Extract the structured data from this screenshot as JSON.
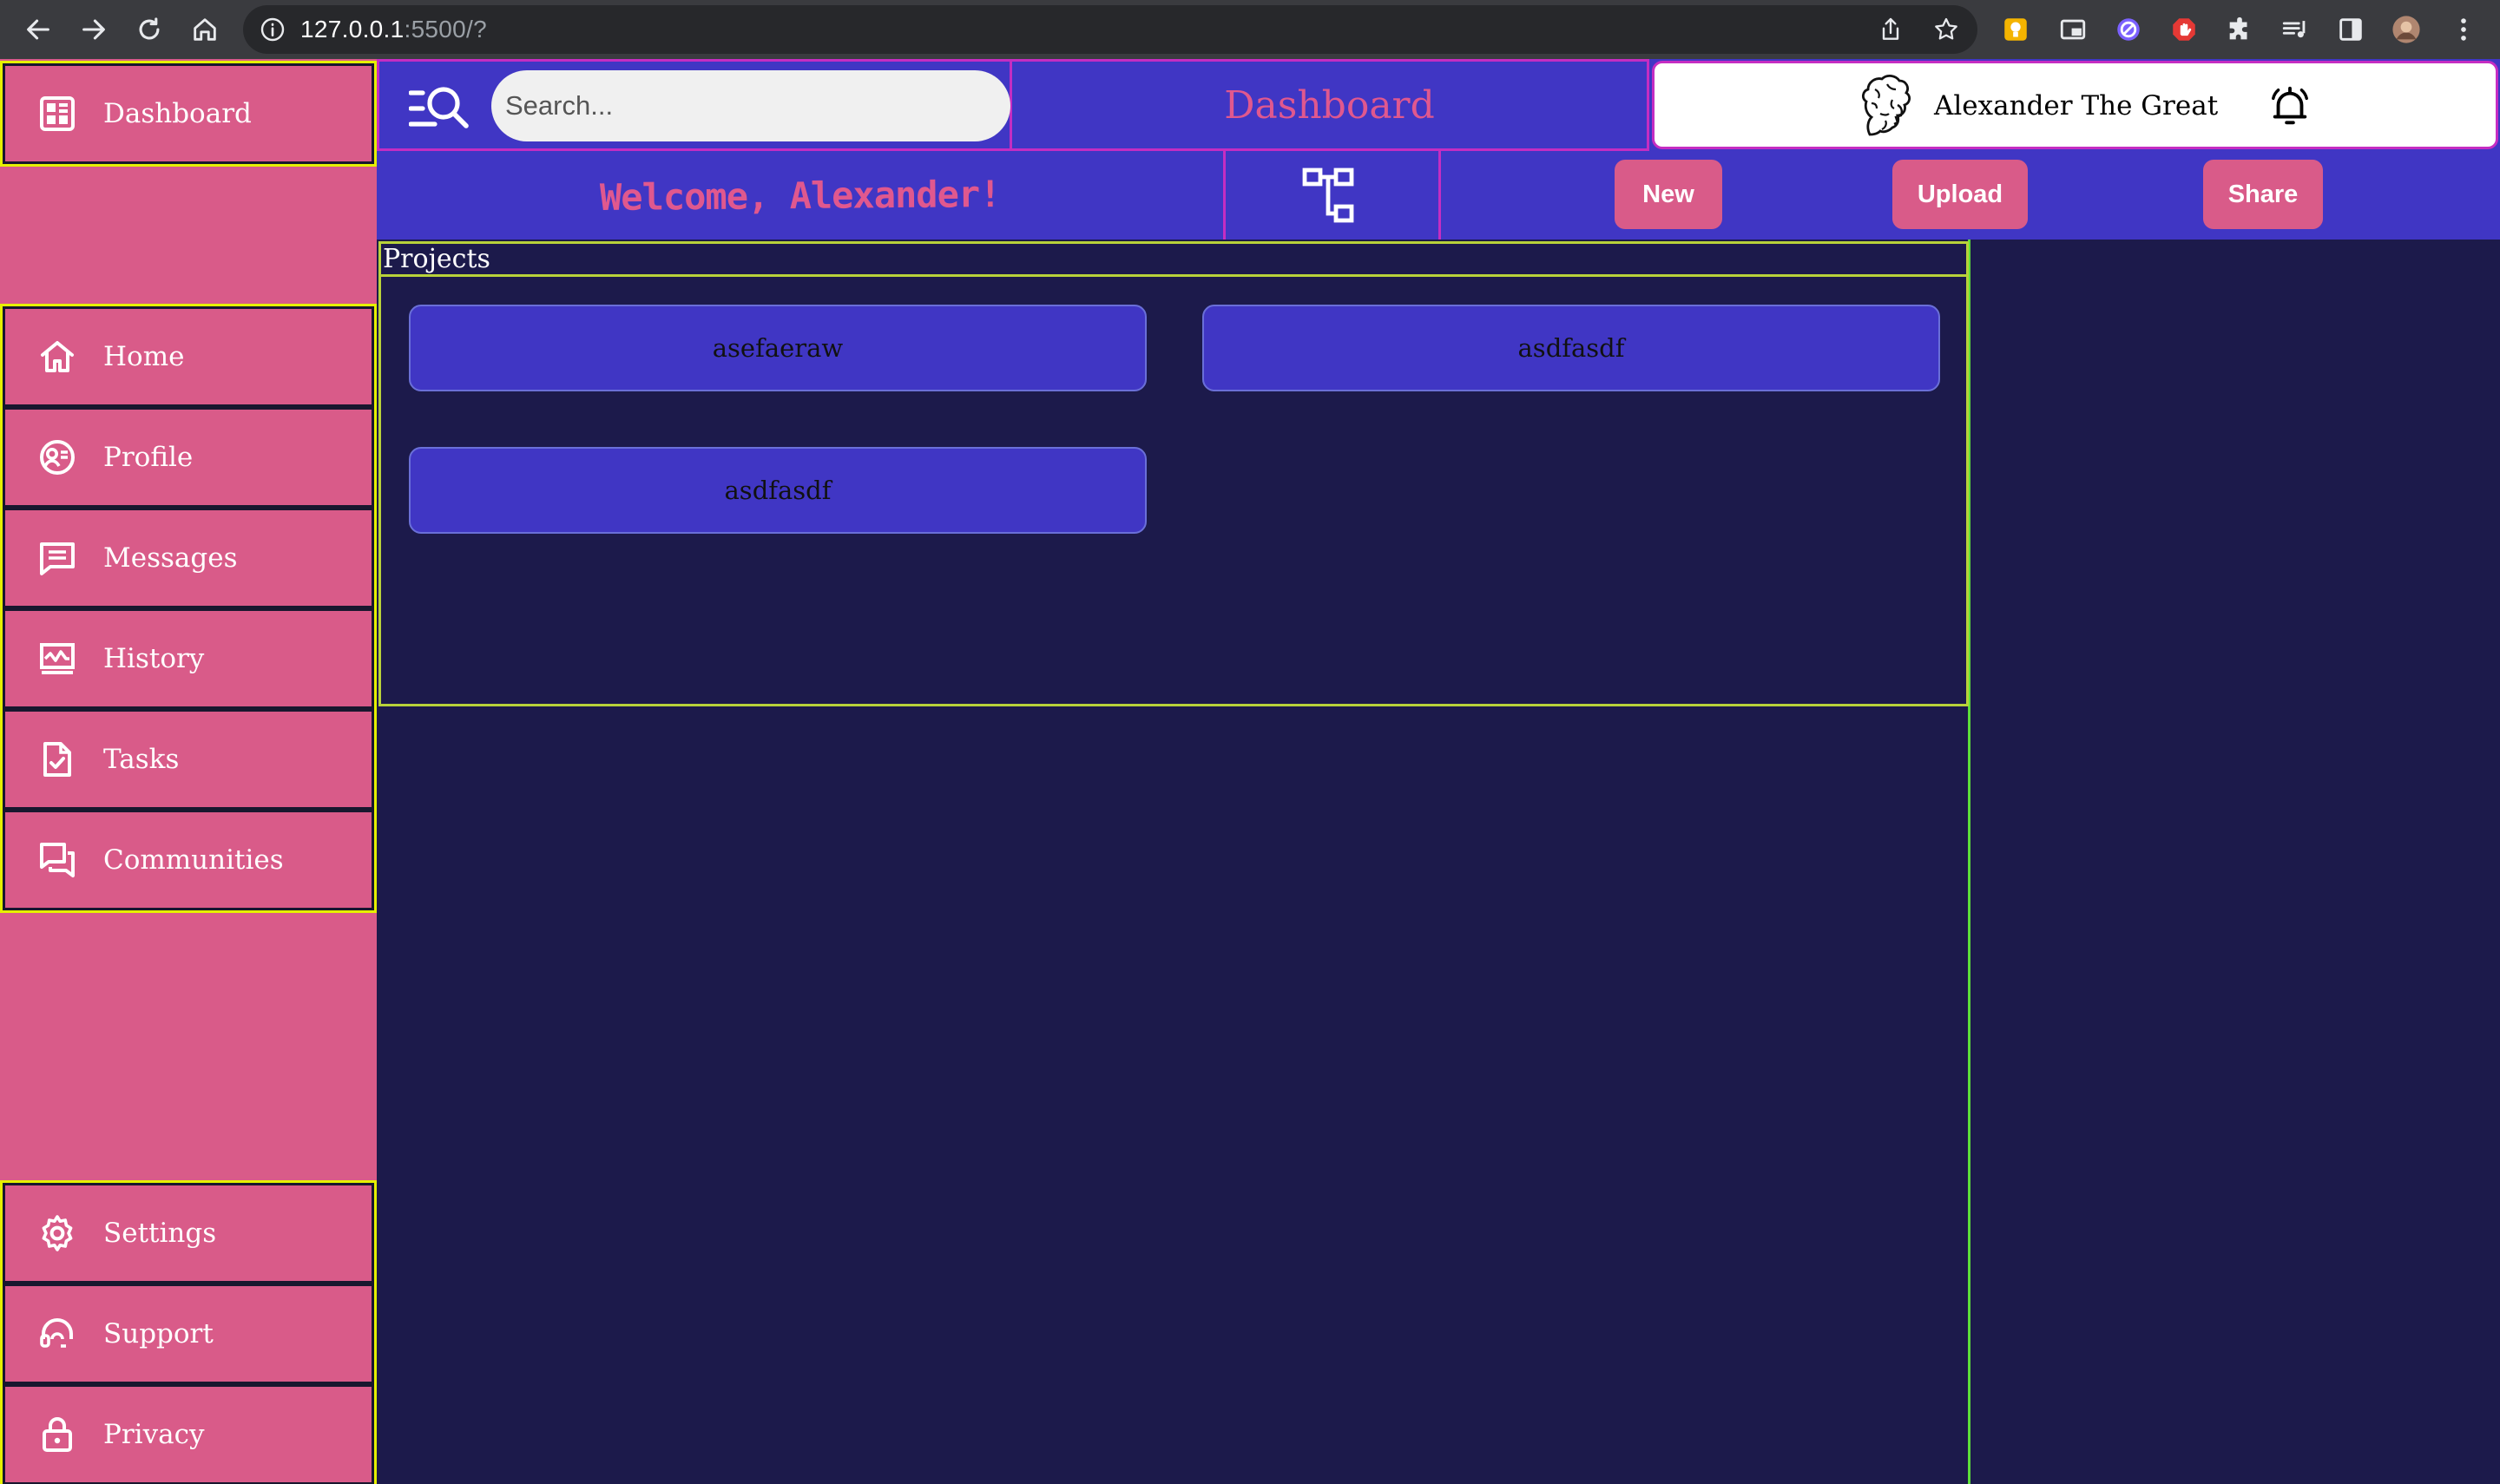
{
  "browser": {
    "url_host": "127.0.0.1",
    "url_rest": ":5500/?"
  },
  "sidebar": {
    "top": {
      "label": "Dashboard",
      "icon": "dashboard-icon"
    },
    "nav": [
      {
        "label": "Home",
        "icon": "home-icon"
      },
      {
        "label": "Profile",
        "icon": "profile-icon"
      },
      {
        "label": "Messages",
        "icon": "messages-icon"
      },
      {
        "label": "History",
        "icon": "history-icon"
      },
      {
        "label": "Tasks",
        "icon": "tasks-icon"
      },
      {
        "label": "Communities",
        "icon": "communities-icon"
      }
    ],
    "bottom": [
      {
        "label": "Settings",
        "icon": "settings-icon"
      },
      {
        "label": "Support",
        "icon": "support-icon"
      },
      {
        "label": "Privacy",
        "icon": "lock-icon"
      }
    ]
  },
  "header": {
    "search_placeholder": "Search...",
    "title": "Dashboard",
    "user_name": "Alexander The Great"
  },
  "actions": {
    "welcome": "Welcome, Alexander!",
    "new_label": "New",
    "upload_label": "Upload",
    "share_label": "Share"
  },
  "projects": {
    "title": "Projects",
    "items": [
      "asefaeraw",
      "asdfasdf",
      "asdfasdf"
    ]
  },
  "colors": {
    "sidebar_bg": "#d95b89",
    "accent_blue": "#4036c4",
    "page_bg": "#1c1a4b",
    "pink_text": "#e0588e",
    "divider_magenta": "#c52dc2",
    "outline_green": "#5dde3a"
  }
}
